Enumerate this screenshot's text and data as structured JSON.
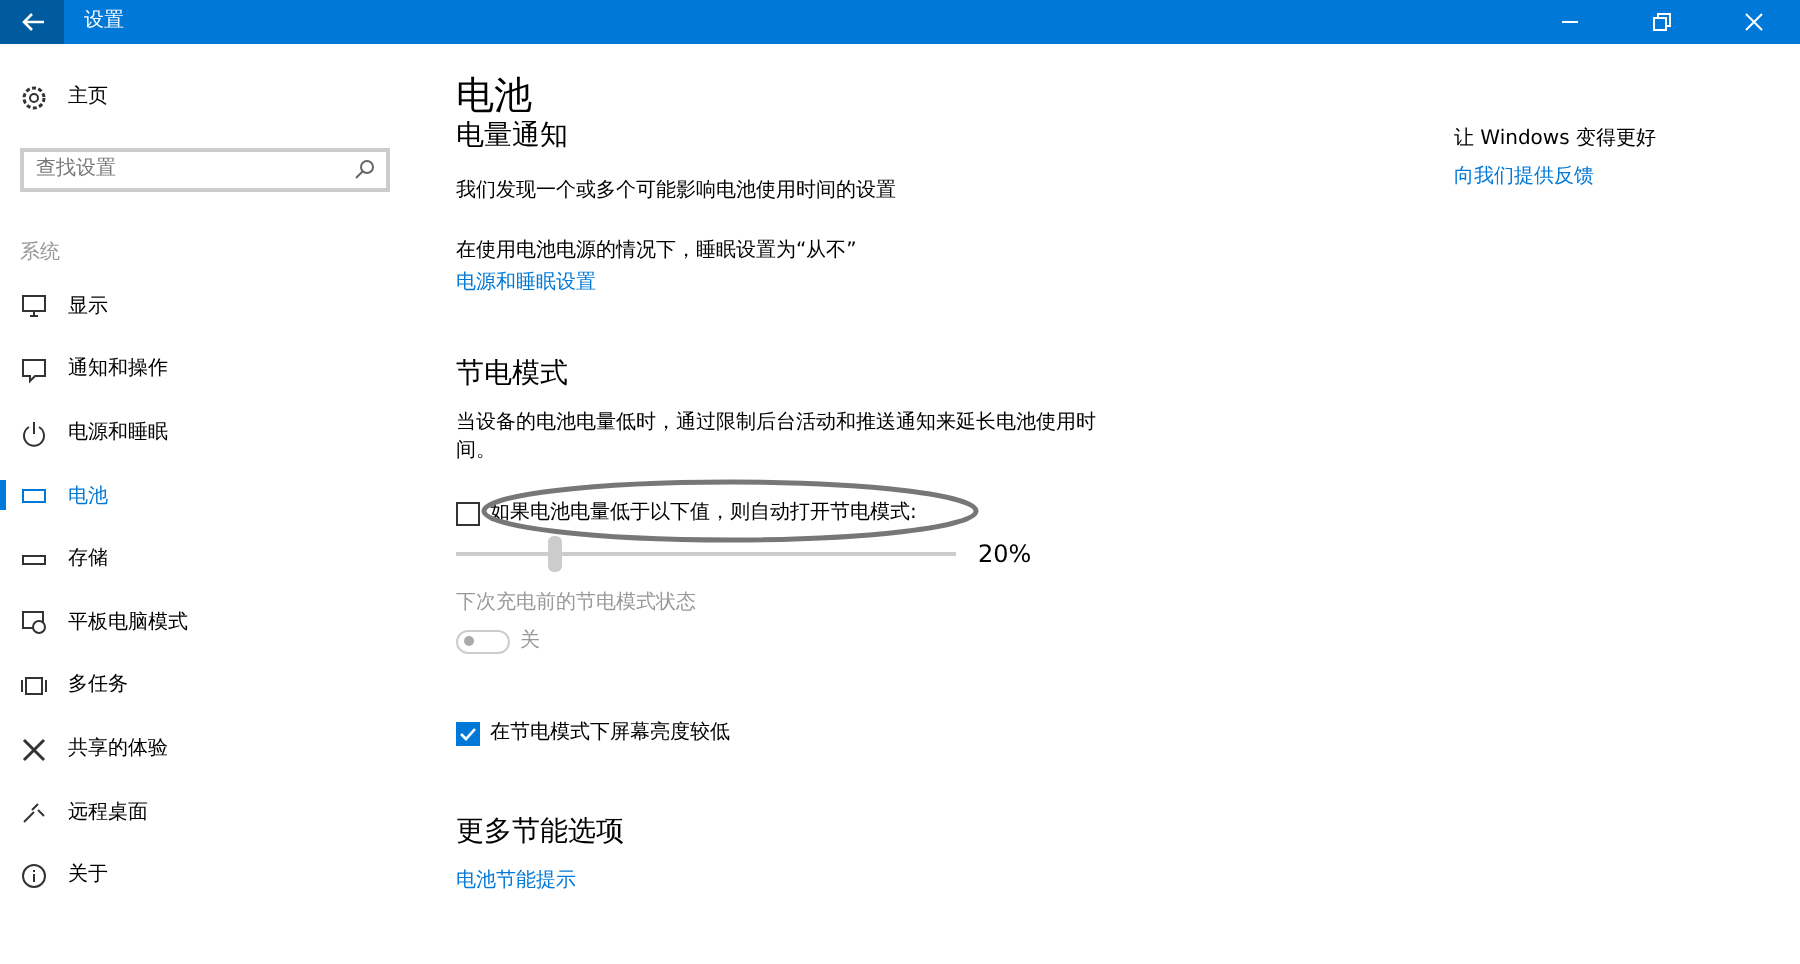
{
  "window": {
    "title": "设置"
  },
  "sidebar": {
    "home": "主页",
    "search": {
      "placeholder": "查找设置"
    },
    "section": "系统",
    "items": [
      {
        "label": "显示",
        "selected": false
      },
      {
        "label": "通知和操作",
        "selected": false
      },
      {
        "label": "电源和睡眠",
        "selected": false
      },
      {
        "label": "电池",
        "selected": true
      },
      {
        "label": "存储",
        "selected": false
      },
      {
        "label": "平板电脑模式",
        "selected": false
      },
      {
        "label": "多任务",
        "selected": false
      },
      {
        "label": "共享的体验",
        "selected": false
      },
      {
        "label": "远程桌面",
        "selected": false
      },
      {
        "label": "关于",
        "selected": false
      }
    ]
  },
  "page_title": "电池",
  "notification": {
    "heading": "电量通知",
    "text": "我们发现一个或多个可能影响电池使用时间的设置",
    "text2": "在使用电池电源的情况下，睡眠设置为“从不”",
    "link": "电源和睡眠设置"
  },
  "saver": {
    "heading": "节电模式",
    "description": "当设备的电池电量低时，通过限制后台活动和推送通知来延长电池使用时间。",
    "auto_on": {
      "label": "如果电池电量低于以下值，则自动打开节电模式:",
      "checked": false
    },
    "slider": {
      "level": 0.2,
      "reading": "20%"
    },
    "status_label": "下次充电前的节电模式状态",
    "toggle": {
      "on": false,
      "disabled": true,
      "label": "关"
    },
    "dim": {
      "label": "在节电模式下屏幕亮度较低",
      "checked": true
    }
  },
  "more": {
    "heading": "更多节能选项",
    "link": "电池节能提示"
  },
  "aside": {
    "text": "让 Windows 变得更好",
    "link": "向我们提供反馈"
  }
}
